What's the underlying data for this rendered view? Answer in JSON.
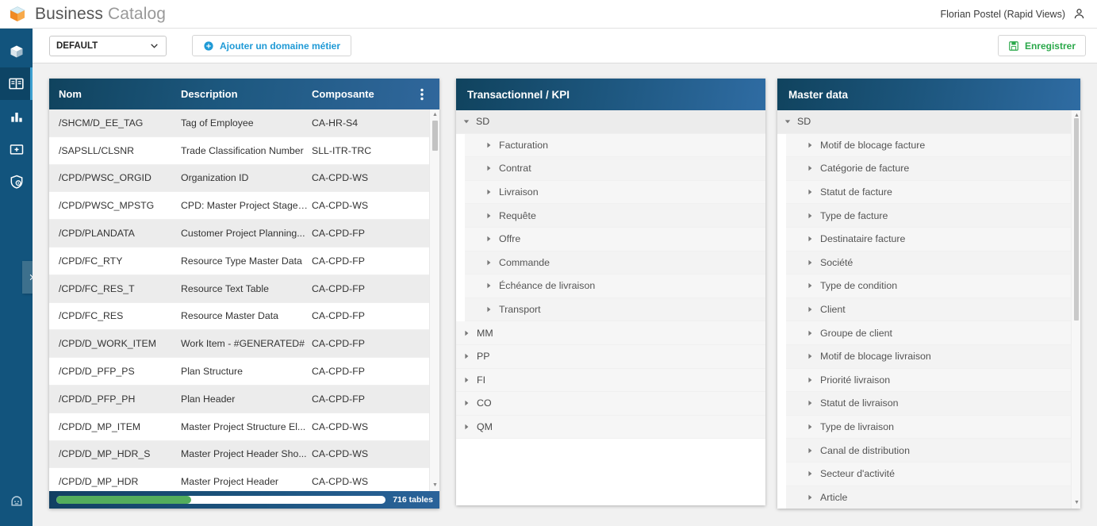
{
  "header": {
    "logo_icon": "orange-cube-logo",
    "title_bold": "Business",
    "title_light": "Catalog",
    "user_name": "Florian Postel (Rapid Views)",
    "user_icon": "person-icon"
  },
  "rail": {
    "items": [
      {
        "icon": "cube-icon",
        "name": "sidebar-item-catalog",
        "active": false
      },
      {
        "icon": "open-book-icon",
        "name": "sidebar-item-glossary",
        "active": true
      },
      {
        "icon": "bar-chart-icon",
        "name": "sidebar-item-reports",
        "active": false
      },
      {
        "icon": "folder-plus-icon",
        "name": "sidebar-item-projects",
        "active": false
      },
      {
        "icon": "shield-lock-icon",
        "name": "sidebar-item-security",
        "active": false
      }
    ],
    "bottom_icon": "robot-assistant-icon",
    "expand_icon": "chevron-right-icon"
  },
  "toolbar": {
    "select_value": "DEFAULT",
    "select_icon": "chevron-down-icon",
    "add_domain_label": "Ajouter un domaine métier",
    "add_domain_icon": "plus-circle-icon",
    "save_label": "Enregistrer",
    "save_icon": "floppy-disk-icon"
  },
  "tables_panel": {
    "columns": [
      "Nom",
      "Description",
      "Composante"
    ],
    "menu_icon": "kebab-menu-icon",
    "rows": [
      {
        "nom": "/CPD/D_MP_HDR",
        "description": "Master Project Header",
        "composante": "CA-CPD-WS"
      },
      {
        "nom": "/CPD/D_MP_HDR_S",
        "description": "Master Project Header Sho...",
        "composante": "CA-CPD-WS"
      },
      {
        "nom": "/CPD/D_MP_ITEM",
        "description": "Master Project Structure El...",
        "composante": "CA-CPD-WS"
      },
      {
        "nom": "/CPD/D_PFP_PH",
        "description": "Plan Header",
        "composante": "CA-CPD-FP"
      },
      {
        "nom": "/CPD/D_PFP_PS",
        "description": "Plan Structure",
        "composante": "CA-CPD-FP"
      },
      {
        "nom": "/CPD/D_WORK_ITEM",
        "description": "Work Item - #GENERATED#",
        "composante": "CA-CPD-FP"
      },
      {
        "nom": "/CPD/FC_RES",
        "description": "Resource Master Data",
        "composante": "CA-CPD-FP"
      },
      {
        "nom": "/CPD/FC_RES_T",
        "description": "Resource Text Table",
        "composante": "CA-CPD-FP"
      },
      {
        "nom": "/CPD/FC_RTY",
        "description": "Resource Type Master Data",
        "composante": "CA-CPD-FP"
      },
      {
        "nom": "/CPD/PLANDATA",
        "description": "Customer Project Planning...",
        "composante": "CA-CPD-FP"
      },
      {
        "nom": "/CPD/PWSC_MPSTG",
        "description": "CPD: Master Project Stage ...",
        "composante": "CA-CPD-WS"
      },
      {
        "nom": "/CPD/PWSC_ORGID",
        "description": "Organization ID",
        "composante": "CA-CPD-WS"
      },
      {
        "nom": "/SAPSLL/CLSNR",
        "description": "Trade Classification Number",
        "composante": "SLL-ITR-TRC"
      },
      {
        "nom": "/SHCM/D_EE_TAG",
        "description": "Tag of Employee",
        "composante": "CA-HR-S4"
      }
    ],
    "footer": {
      "count_label": "716 tables",
      "progress_percent": 41,
      "progress_color": "#53ad5c"
    }
  },
  "transactional_panel": {
    "title": "Transactionnel / KPI",
    "nodes": [
      {
        "label": "SD",
        "expanded": true,
        "children": [
          "Facturation",
          "Contrat",
          "Livraison",
          "Requête",
          "Offre",
          "Commande",
          "Échéance de livraison",
          "Transport"
        ]
      },
      {
        "label": "MM",
        "expanded": false,
        "children": []
      },
      {
        "label": "PP",
        "expanded": false,
        "children": []
      },
      {
        "label": "FI",
        "expanded": false,
        "children": []
      },
      {
        "label": "CO",
        "expanded": false,
        "children": []
      },
      {
        "label": "QM",
        "expanded": false,
        "children": []
      }
    ]
  },
  "master_panel": {
    "title": "Master data",
    "nodes": [
      {
        "label": "SD",
        "expanded": true,
        "children": [
          "Motif de blocage facture",
          "Catégorie de facture",
          "Statut de facture",
          "Type de facture",
          "Destinataire facture",
          "Société",
          "Type de condition",
          "Client",
          "Groupe de client",
          "Motif de blocage livraison",
          "Priorité livraison",
          "Statut de livraison",
          "Type de livraison",
          "Canal de distribution",
          "Secteur d'activité",
          "Article"
        ]
      }
    ]
  },
  "colors": {
    "rail": "#12547d",
    "panel_header_start": "#10435e",
    "panel_header_end": "#2f6ca3",
    "accent_blue": "#1f9ad6",
    "accent_green": "#2aa84a",
    "logo_orange": "#f08a24"
  }
}
